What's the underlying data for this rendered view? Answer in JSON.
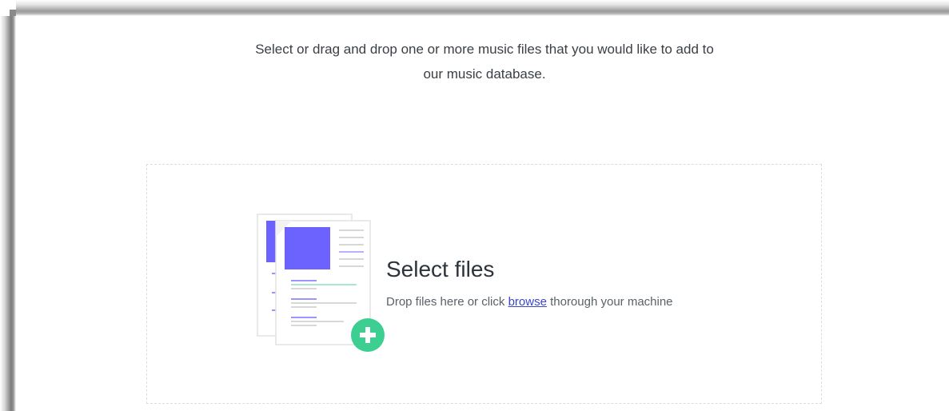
{
  "intro": {
    "line1": "Select or drag and drop one or more music files that you would like to add to",
    "line2": "our music database."
  },
  "dropzone": {
    "title": "Select files",
    "hint_before": "Drop files here or click ",
    "browse_label": "browse",
    "hint_after": " thorough your machine"
  },
  "illustration": {
    "icon": "documents-add-icon",
    "accent_color": "#6c63ff",
    "plus_color": "#3ccf91"
  }
}
